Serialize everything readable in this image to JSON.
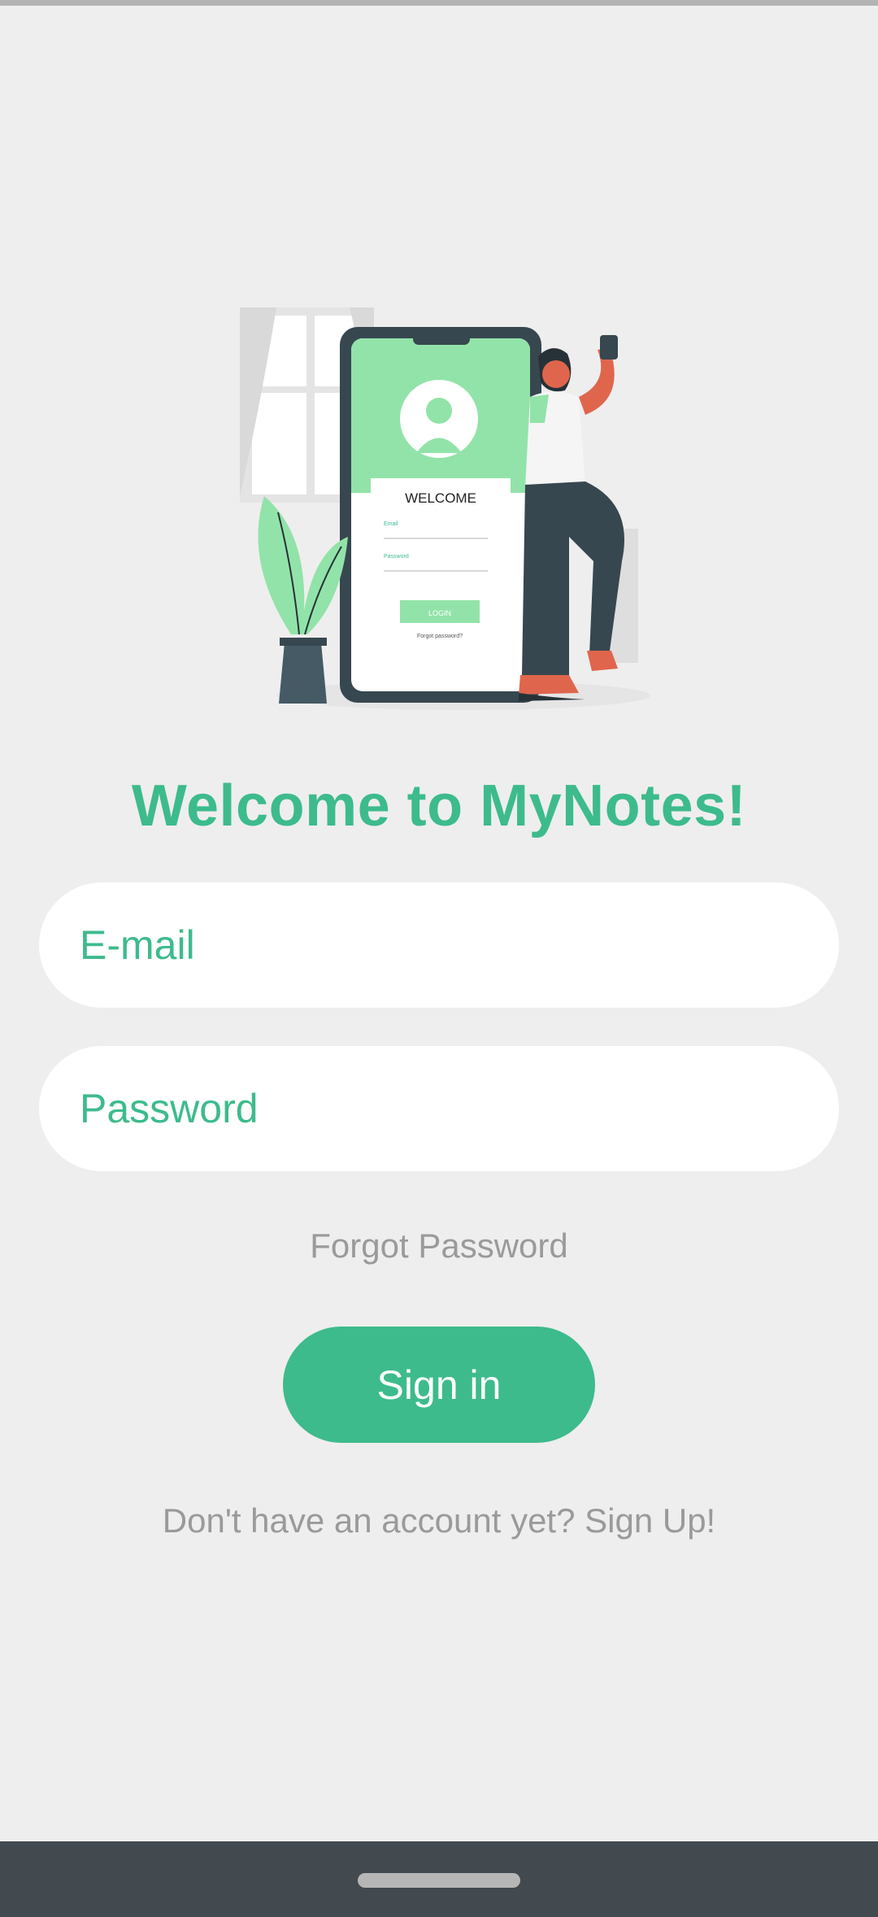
{
  "app": {
    "title": "Welcome to MyNotes!"
  },
  "illustration": {
    "icon": "login-illustration",
    "phone_heading": "WELCOME",
    "phone_email_label": "Email",
    "phone_password_label": "Password",
    "phone_login_label": "LOGIN",
    "phone_forgot_label": "Forgot password?"
  },
  "form": {
    "email_placeholder": "E-mail",
    "password_placeholder": "Password",
    "forgot_label": "Forgot Password",
    "signin_label": "Sign in",
    "signup_label": "Don't have an account yet? Sign Up!"
  },
  "colors": {
    "accent": "#3dbb8c",
    "muted_text": "#9a9a9a",
    "background": "#eeeeee",
    "nav_bar": "#424a50"
  }
}
